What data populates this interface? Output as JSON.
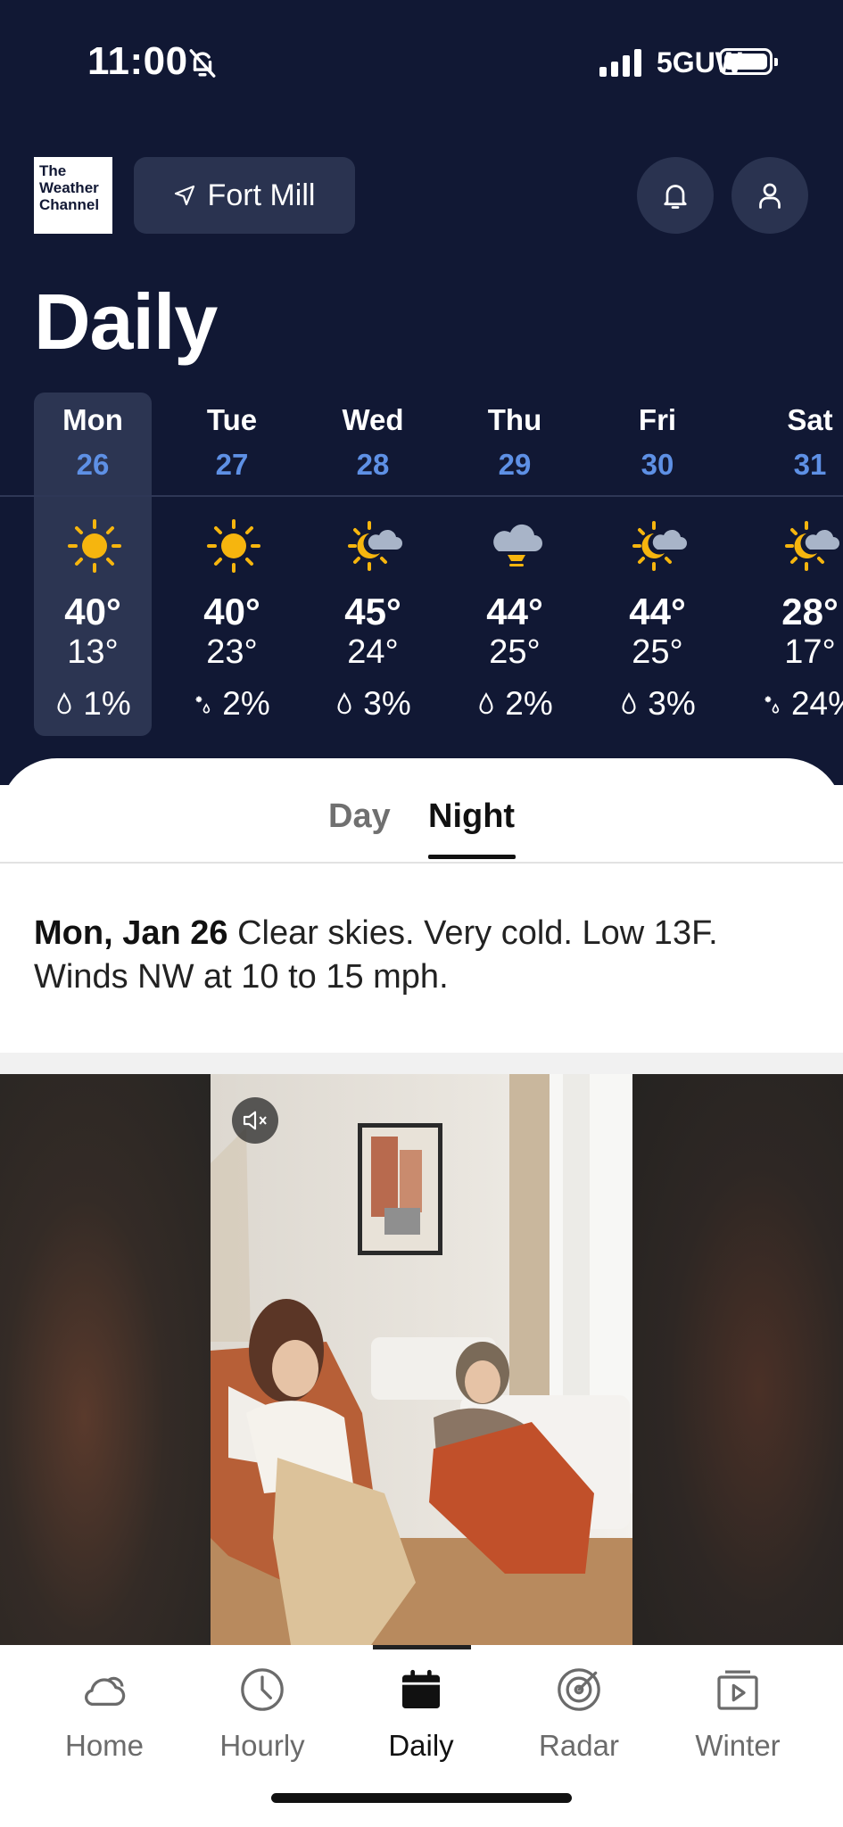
{
  "status_bar": {
    "time": "11:00",
    "network": "5GUW",
    "icons": [
      "bell-off-icon",
      "signal-icon",
      "battery-icon"
    ]
  },
  "header": {
    "logo_lines": [
      "The",
      "Weather",
      "Channel"
    ],
    "location": "Fort Mill",
    "location_icon": "location-arrow-icon",
    "notification_icon": "bell-icon",
    "profile_icon": "person-icon"
  },
  "page_title": "Daily",
  "days": [
    {
      "name": "Mon",
      "date": "26",
      "icon": "sun-icon",
      "high": "40°",
      "low": "13°",
      "precip_icon": "raindrop-icon",
      "precip": "1%",
      "selected": true
    },
    {
      "name": "Tue",
      "date": "27",
      "icon": "sun-icon",
      "high": "40°",
      "low": "23°",
      "precip_icon": "snowflake-icon",
      "precip": "2%"
    },
    {
      "name": "Wed",
      "date": "28",
      "icon": "partly-cloudy-icon",
      "high": "45°",
      "low": "24°",
      "precip_icon": "raindrop-icon",
      "precip": "3%"
    },
    {
      "name": "Thu",
      "date": "29",
      "icon": "cloudy-icon",
      "high": "44°",
      "low": "25°",
      "precip_icon": "raindrop-icon",
      "precip": "2%"
    },
    {
      "name": "Fri",
      "date": "30",
      "icon": "partly-cloudy-icon",
      "high": "44°",
      "low": "25°",
      "precip_icon": "raindrop-icon",
      "precip": "3%"
    },
    {
      "name": "Sat",
      "date": "31",
      "icon": "partly-cloudy-icon",
      "high": "28°",
      "low": "17°",
      "precip_icon": "snowflake-icon",
      "precip": "24%"
    }
  ],
  "tabs": {
    "day": "Day",
    "night": "Night",
    "active": "Night"
  },
  "narrative": {
    "date": "Mon, Jan 26",
    "text": "Clear skies. Very cold. Low 13F. Winds NW at 10 to 15 mph."
  },
  "ad_video": {
    "mute_icon": "speaker-mute-icon"
  },
  "bottom_nav": [
    {
      "label": "Home",
      "icon": "cloud-icon"
    },
    {
      "label": "Hourly",
      "icon": "clock-icon"
    },
    {
      "label": "Daily",
      "icon": "calendar-icon",
      "active": true
    },
    {
      "label": "Radar",
      "icon": "radar-icon"
    },
    {
      "label": "Winter",
      "icon": "video-play-icon"
    }
  ],
  "colors": {
    "header_bg": "#111834",
    "selected_day_bg": "#2c3552",
    "date_blue": "#5e90e5",
    "sun": "#f6b50e",
    "cloud": "#a8b4c8"
  }
}
